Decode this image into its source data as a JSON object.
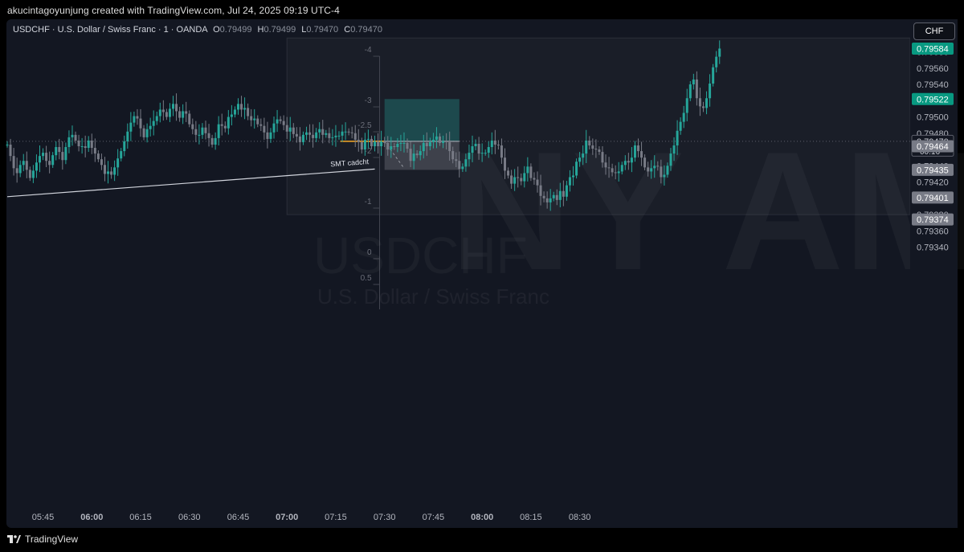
{
  "header": {
    "credit": "akucintagoyunjung created with TradingView.com, Jul 24, 2025 09:19 UTC-4"
  },
  "legend": {
    "symbol": "USDCHF · U.S. Dollar / Swiss Franc · 1 · OANDA",
    "o_label": "O",
    "o": "0.79499",
    "h_label": "H",
    "h": "0.79499",
    "l_label": "L",
    "l": "0.79470",
    "c_label": "C",
    "c": "0.79470"
  },
  "currency_button": "CHF",
  "watermark": {
    "symbol": "USDCHF",
    "name": "U.S. Dollar / Swiss Franc",
    "session": "NY AM"
  },
  "footer": {
    "brand": "TradingView"
  },
  "colors": {
    "up": "#26a69a",
    "down": "#787b86",
    "background": "#131722",
    "target_zone": "#26a69a",
    "trendline": "#d1d4dc"
  },
  "chart_data": {
    "type": "candlestick",
    "symbol": "USDCHF",
    "interval": "1",
    "ylim": [
      0.79322,
      0.79602
    ],
    "price_ticks": [
      "0.79580",
      "0.79560",
      "0.79540",
      "0.79500",
      "0.79480",
      "0.79440",
      "0.79420",
      "0.79380",
      "0.79360",
      "0.79340"
    ],
    "price_tags": [
      {
        "label": "0.79584",
        "price": 0.79584,
        "style": "green"
      },
      {
        "label": "0.79522",
        "price": 0.79522,
        "style": "green"
      },
      {
        "label": "0.79470",
        "price": 0.7947,
        "style": "current",
        "sub": "00:16"
      },
      {
        "label": "0.79464",
        "price": 0.79464,
        "style": "gray"
      },
      {
        "label": "0.79435",
        "price": 0.79435,
        "style": "gray"
      },
      {
        "label": "0.79401",
        "price": 0.79401,
        "style": "gray"
      },
      {
        "label": "0.79374",
        "price": 0.79374,
        "style": "gray"
      }
    ],
    "time_ticks": [
      {
        "label": "05:45",
        "bold": false
      },
      {
        "label": "06:00",
        "bold": true
      },
      {
        "label": "06:15",
        "bold": false
      },
      {
        "label": "06:30",
        "bold": false
      },
      {
        "label": "06:45",
        "bold": false
      },
      {
        "label": "07:00",
        "bold": true
      },
      {
        "label": "07:15",
        "bold": false
      },
      {
        "label": "07:30",
        "bold": false
      },
      {
        "label": "07:45",
        "bold": false
      },
      {
        "label": "08:00",
        "bold": true
      },
      {
        "label": "08:15",
        "bold": false
      },
      {
        "label": "08:30",
        "bold": false
      }
    ],
    "start_time": "05:34",
    "closes": [
      0.79466,
      0.79452,
      0.79437,
      0.79431,
      0.79441,
      0.79446,
      0.79435,
      0.79425,
      0.79434,
      0.79444,
      0.79452,
      0.79456,
      0.79446,
      0.79441,
      0.79453,
      0.79463,
      0.79457,
      0.79447,
      0.79463,
      0.79475,
      0.79478,
      0.79471,
      0.79464,
      0.79464,
      0.79462,
      0.79471,
      0.79462,
      0.79455,
      0.79448,
      0.79441,
      0.7943,
      0.79433,
      0.79429,
      0.79438,
      0.79449,
      0.79458,
      0.7947,
      0.79482,
      0.79493,
      0.79501,
      0.79498,
      0.79486,
      0.79475,
      0.79485,
      0.79489,
      0.79495,
      0.79501,
      0.79509,
      0.79506,
      0.795,
      0.7951,
      0.79516,
      0.79507,
      0.79499,
      0.79507,
      0.79504,
      0.79491,
      0.79485,
      0.79478,
      0.79478,
      0.79487,
      0.7948,
      0.79474,
      0.79466,
      0.79474,
      0.79491,
      0.79489,
      0.79486,
      0.795,
      0.79503,
      0.79509,
      0.79516,
      0.79509,
      0.79511,
      0.79501,
      0.79496,
      0.79498,
      0.79491,
      0.79489,
      0.79481,
      0.79473,
      0.79481,
      0.79492,
      0.79497,
      0.79495,
      0.7949,
      0.79482,
      0.79487,
      0.79479,
      0.79476,
      0.79469,
      0.79478,
      0.79481,
      0.79478,
      0.79474,
      0.79481,
      0.79485,
      0.79478,
      0.7948,
      0.79474,
      0.79475,
      0.79477,
      0.79477,
      0.79482,
      0.79482,
      0.79481,
      0.7948,
      0.79472,
      0.79469,
      0.7946,
      0.79472,
      0.79473,
      0.79464,
      0.7947,
      0.79464,
      0.7947,
      0.79468,
      0.7946,
      0.79464,
      0.79463,
      0.79467,
      0.79468,
      0.79468,
      0.79461,
      0.79446,
      0.79455,
      0.79453,
      0.79458,
      0.79468,
      0.79464,
      0.79469,
      0.79472,
      0.79476,
      0.79468,
      0.7947,
      0.79469,
      0.79458,
      0.79448,
      0.79446,
      0.79436,
      0.79439,
      0.79448,
      0.79456,
      0.79464,
      0.79467,
      0.79455,
      0.79456,
      0.79456,
      0.79463,
      0.79471,
      0.79466,
      0.79465,
      0.7945,
      0.79434,
      0.79428,
      0.79418,
      0.79426,
      0.79425,
      0.79421,
      0.79431,
      0.79439,
      0.79425,
      0.79423,
      0.79416,
      0.79403,
      0.794,
      0.79395,
      0.794,
      0.79404,
      0.79398,
      0.79409,
      0.79402,
      0.79416,
      0.79426,
      0.79428,
      0.79445,
      0.7945,
      0.79455,
      0.79471,
      0.79465,
      0.79461,
      0.7946,
      0.79457,
      0.79444,
      0.79438,
      0.79437,
      0.79432,
      0.79431,
      0.79433,
      0.79441,
      0.79446,
      0.79444,
      0.7945,
      0.79465,
      0.79458,
      0.7945,
      0.79438,
      0.79433,
      0.79437,
      0.7944,
      0.79439,
      0.79426,
      0.79429,
      0.7944,
      0.79455,
      0.79465,
      0.79483,
      0.79494,
      0.79505,
      0.79523,
      0.7954,
      0.79546,
      0.79523,
      0.79513,
      0.79511,
      0.79523,
      0.79541,
      0.79561,
      0.79574,
      0.79584
    ],
    "opens": [
      0.79466,
      0.79466,
      0.79452,
      0.79437,
      0.79431,
      0.79441,
      0.79446,
      0.79435,
      0.79425,
      0.79434,
      0.79444,
      0.79452,
      0.79456,
      0.79446,
      0.79441,
      0.79453,
      0.79463,
      0.79457,
      0.79447,
      0.79463,
      0.79475,
      0.79478,
      0.79471,
      0.79464,
      0.79464,
      0.79462,
      0.79471,
      0.79462,
      0.79455,
      0.79448,
      0.79441,
      0.7943,
      0.79433,
      0.79429,
      0.79438,
      0.79449,
      0.79458,
      0.7947,
      0.79482,
      0.79493,
      0.79501,
      0.79498,
      0.79486,
      0.79475,
      0.79485,
      0.79489,
      0.79495,
      0.79501,
      0.79509,
      0.79506,
      0.795,
      0.7951,
      0.79516,
      0.79507,
      0.79499,
      0.79507,
      0.79504,
      0.79491,
      0.79485,
      0.79478,
      0.79478,
      0.79487,
      0.7948,
      0.79474,
      0.79466,
      0.79474,
      0.79491,
      0.79489,
      0.79486,
      0.795,
      0.79503,
      0.79509,
      0.79516,
      0.79509,
      0.79511,
      0.79501,
      0.79496,
      0.79498,
      0.79491,
      0.79489,
      0.79481,
      0.79473,
      0.79481,
      0.79492,
      0.79497,
      0.79495,
      0.7949,
      0.79482,
      0.79487,
      0.79479,
      0.79476,
      0.79469,
      0.79478,
      0.79481,
      0.79478,
      0.79474,
      0.79481,
      0.79485,
      0.79478,
      0.7948,
      0.79474,
      0.79475,
      0.79477,
      0.79477,
      0.79482,
      0.79482,
      0.79481,
      0.7948,
      0.79472,
      0.79469,
      0.7946,
      0.79472,
      0.79473,
      0.79464,
      0.7947,
      0.79464,
      0.7947,
      0.79468,
      0.7946,
      0.79464,
      0.79463,
      0.79467,
      0.79468,
      0.79468,
      0.79461,
      0.79446,
      0.79455,
      0.79453,
      0.79458,
      0.79468,
      0.79464,
      0.79469,
      0.79472,
      0.79476,
      0.79468,
      0.7947,
      0.79469,
      0.79458,
      0.79448,
      0.79446,
      0.79436,
      0.79439,
      0.79448,
      0.79456,
      0.79464,
      0.79467,
      0.79455,
      0.79456,
      0.79456,
      0.79463,
      0.79471,
      0.79466,
      0.79465,
      0.7945,
      0.79434,
      0.79428,
      0.79418,
      0.79426,
      0.79425,
      0.79421,
      0.79431,
      0.79439,
      0.79425,
      0.79423,
      0.79416,
      0.79403,
      0.794,
      0.79395,
      0.794,
      0.79404,
      0.79398,
      0.79409,
      0.79402,
      0.79416,
      0.79426,
      0.79428,
      0.79445,
      0.7945,
      0.79455,
      0.79471,
      0.79465,
      0.79461,
      0.7946,
      0.79457,
      0.79444,
      0.79438,
      0.79437,
      0.79432,
      0.79431,
      0.79433,
      0.79441,
      0.79446,
      0.79444,
      0.7945,
      0.79465,
      0.79458,
      0.7945,
      0.79438,
      0.79433,
      0.79437,
      0.7944,
      0.79439,
      0.79426,
      0.79429,
      0.7944,
      0.79455,
      0.79465,
      0.79483,
      0.79494,
      0.79505,
      0.79523,
      0.7954,
      0.79546,
      0.79523,
      0.79513,
      0.79511,
      0.79523,
      0.79541,
      0.79561,
      0.79574
    ],
    "annotations": {
      "trendline": {
        "from_time": "05:34",
        "from_price": 0.79402,
        "to_time": "07:27",
        "to_price": 0.79436,
        "label": "SMT cadcht"
      },
      "position_ticks": [
        "-4",
        "-3",
        "-2.5",
        "-2",
        "-1",
        "0",
        "0.5"
      ],
      "target_zone": {
        "top_price": 0.79522,
        "bottom_price": 0.7947,
        "from_time": "07:30",
        "to_time": "07:53"
      },
      "stop_zone": {
        "top_price": 0.7947,
        "bottom_price": 0.79435,
        "from_time": "07:30",
        "to_time": "07:53"
      },
      "session_box": {
        "from_time": "07:00",
        "top_price": 0.79597,
        "bottom_price": 0.7938
      }
    }
  }
}
